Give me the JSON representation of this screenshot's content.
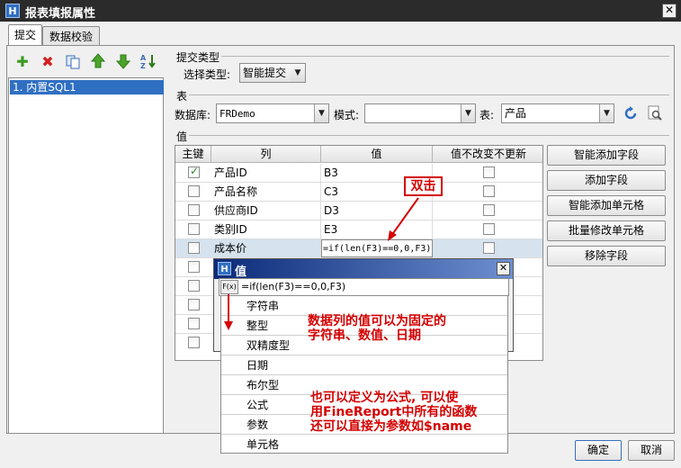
{
  "window": {
    "title": "报表填报属性",
    "close_glyph": "✕"
  },
  "tabs": [
    {
      "label": "提交"
    },
    {
      "label": "数据校验"
    }
  ],
  "toolbar_icons": [
    "add-icon",
    "delete-icon",
    "copy-icon",
    "move-up-icon",
    "move-down-icon",
    "sort-icon"
  ],
  "list": {
    "items": [
      {
        "label": "1. 内置SQL1"
      }
    ]
  },
  "submit_type": {
    "group_title": "提交类型",
    "label": "选择类型:",
    "value": "智能提交"
  },
  "table_group": {
    "group_title": "表",
    "db_label": "数据库:",
    "db_value": "FRDemo",
    "schema_label": "模式:",
    "schema_value": "",
    "table_label": "表:",
    "table_value": "产品"
  },
  "values_group": {
    "group_title": "值",
    "headers": [
      "主键",
      "列",
      "值",
      "值不改变不更新"
    ],
    "rows": [
      {
        "key": true,
        "column": "产品ID",
        "value": "B3",
        "no_update": false
      },
      {
        "key": false,
        "column": "产品名称",
        "value": "C3",
        "no_update": false
      },
      {
        "key": false,
        "column": "供应商ID",
        "value": "D3",
        "no_update": false
      },
      {
        "key": false,
        "column": "类别ID",
        "value": "E3",
        "no_update": false
      },
      {
        "key": false,
        "column": "成本价",
        "value": "=if(len(F3)==0,0,F3)",
        "no_update": false
      }
    ]
  },
  "side_buttons": [
    "智能添加字段",
    "添加字段",
    "智能添加单元格",
    "批量修改单元格",
    "移除字段"
  ],
  "annotation": {
    "double_click": "双击",
    "note1_line1": "数据列的值可以为固定的",
    "note1_line2": "字符串、数值、日期",
    "note2_line1": "也可以定义为公式, 可以使",
    "note2_line2": "用FineReport中所有的函数",
    "note2_line3": "还可以直接为参数如$name"
  },
  "popup": {
    "title": "值",
    "fx_label": "F(x)",
    "formula": "=if(len(F3)==0,0,F3)",
    "types": [
      "字符串",
      "整型",
      "双精度型",
      "日期",
      "布尔型",
      "公式",
      "参数",
      "单元格"
    ]
  },
  "footer": {
    "ok": "确定",
    "cancel": "取消"
  },
  "colors": {
    "selection": "#2f6fc2",
    "annotation": "#d40000",
    "row_selected": "#d6e2ee"
  }
}
